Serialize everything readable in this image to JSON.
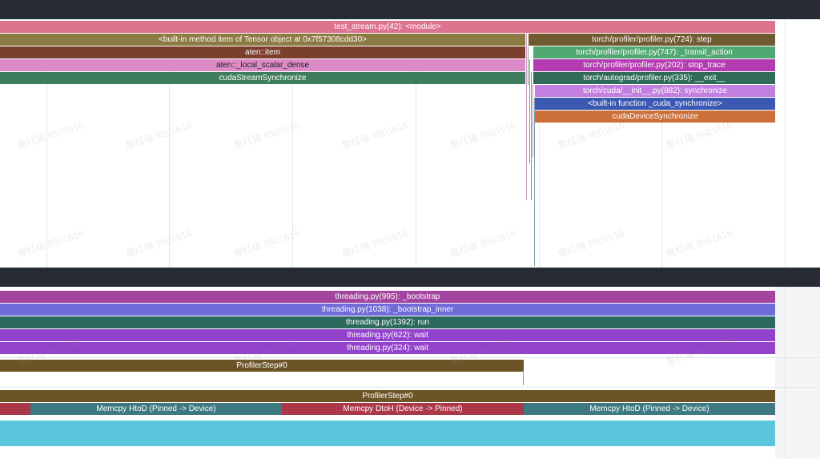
{
  "colors": {
    "header": "#272b35",
    "module": "#de7390",
    "item_method": "#8b7a42",
    "aten_item": "#7b3f2e",
    "local_scalar": "#dc8ac6",
    "cuda_sync": "#3e7d5d",
    "step": "#705a2f",
    "transit": "#52a872",
    "stop_trace": "#b43cb1",
    "autograd_exit": "#2f6b58",
    "cuda_init_sync": "#c27fe0",
    "builtin_cuda": "#3b58b2",
    "device_sync": "#cd6f38",
    "bootstrap": "#a3449e",
    "bootstrap_inner": "#6f6bd9",
    "run": "#2c6a5d",
    "wait": "#9342cc",
    "profiler_step": "#6b5527",
    "memcpy_htod": "#3e7982",
    "memcpy_dtoh": "#ab3849",
    "gpu_util": "#5ac6de"
  },
  "cpu_thread": {
    "slices": [
      "test_stream.py(42): <module>",
      "<built-in method item of Tensor object at 0x7f57308cdd30>",
      "aten::item",
      "aten::_local_scalar_dense",
      "cudaStreamSynchronize",
      "torch/profiler/profiler.py(724): step",
      "torch/profiler/profiler.py(747): _transit_action",
      "torch/profiler/profiler.py(202): stop_trace",
      "torch/autograd/profiler.py(335): __exit__",
      "torch/cuda/__init__.py(882): synchronize",
      "<built-in function _cuda_synchronize>",
      "cudaDeviceSynchronize"
    ]
  },
  "python_thread": {
    "slices": [
      "threading.py(995): _bootstrap",
      "threading.py(1038): _bootstrap_inner",
      "threading.py(1392): run",
      "threading.py(622): wait",
      "threading.py(324): wait"
    ]
  },
  "profiler_step_cpu": "ProfilerStep#0",
  "gpu_stream": {
    "profiler_step": "ProfilerStep#0",
    "memcpy": [
      "Memcpy HtoD (Pinned -> Device)",
      "Memcpy DtoH (Device -> Pinned)",
      "Memcpy HtoD (Pinned -> Device)"
    ]
  },
  "watermark": "詹红瑞 9501616"
}
